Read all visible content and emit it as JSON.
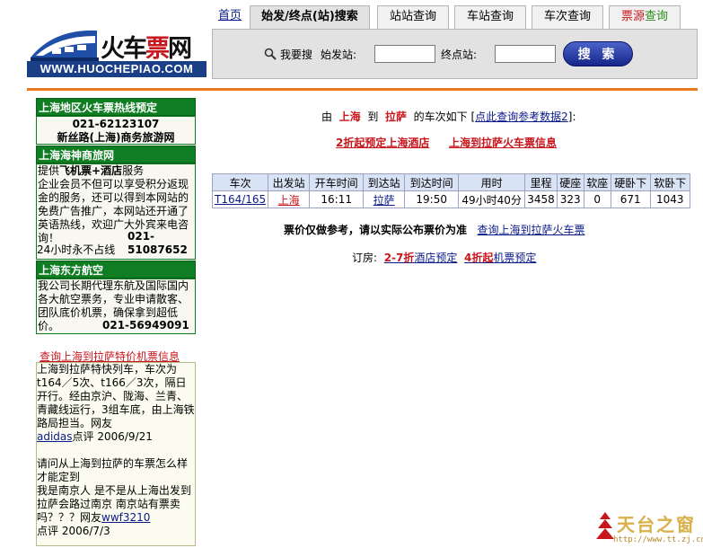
{
  "logo": {
    "cn_prefix": "火车",
    "cn_red": "票",
    "cn_suffix": "网",
    "en": "WWW.HUOCHEPIAO.COM"
  },
  "tabs": [
    {
      "label": "首页"
    },
    {
      "label": "始发/终点(站)搜索"
    },
    {
      "label": "站站查询"
    },
    {
      "label": "车站查询"
    },
    {
      "label": "车次查询"
    },
    {
      "label_a": "票源",
      "label_b": "查询"
    }
  ],
  "search": {
    "prompt": "我要搜",
    "from_label": "始发站:",
    "from_value": "",
    "to_label": "终点站:",
    "to_value": "",
    "button": "搜 索"
  },
  "sidebar": {
    "hotline": {
      "title": "上海地区火车票热线预定",
      "phone": "021-62123107",
      "company": "新丝路(上海)商务旅游网"
    },
    "shenshang": {
      "title": "上海海神商旅网",
      "text_a": "提供",
      "text_b": "飞机票+酒店",
      "text_c": "服务",
      "text_d": "企业会员不但可以享受积分返现金的服务，还可以得到本网站的免费广告推广，本网站还开通了英语热线，欢迎广大外宾来电咨询！",
      "phone": "021-51087652",
      "hours": "24小时永不占线"
    },
    "eastern": {
      "title": "上海东方航空",
      "text": "我公司长期代理东航及国际国内各大航空票务，专业申请散客、团队底价机票，确保拿到超低价。",
      "phone": "021-56949091"
    },
    "flight_link": "查询上海到拉萨特价机票信息",
    "comments": {
      "c1_text": "上海到拉萨特快列车，车次为t164／5次、t166／3次，隔日开行。经由京沪、陇海、兰青、青藏线运行，3组车底，由上海铁路局担当。网友",
      "c1_user": "adidas",
      "c1_meta": "点评 2006/9/21",
      "c2_text": "请问从上海到拉萨的车票怎么样才能定到\n我是南京人 是不是从上海出发到拉萨会路过南京 南京站有票卖吗？？？网友",
      "c2_user": "wwf3210",
      "c2_meta": "点评 2006/7/3"
    }
  },
  "main": {
    "intro_a": "由",
    "from": "上海",
    "intro_b": "到",
    "to": "拉萨",
    "intro_c": "的车次如下",
    "ref_open": "[",
    "ref_link": "点此查询参考数据2",
    "ref_close": "]:",
    "promo_hotel": "2折起预定上海酒店",
    "promo_ticket": "上海到拉萨火车票信息",
    "table": {
      "headers": [
        "车次",
        "出发站",
        "开车时间",
        "到达站",
        "到达时间",
        "用时",
        "里程",
        "硬座",
        "软座",
        "硬卧下",
        "软卧下"
      ],
      "rows": [
        [
          "T164/165",
          "上海",
          "16:11",
          "拉萨",
          "19:50",
          "49小时40分",
          "3458",
          "323",
          "0",
          "671",
          "1043"
        ]
      ]
    },
    "note_bold": "票价仅做参考，请以实际公布票价为准",
    "note_link": "查询上海到拉萨火车票",
    "booking_label": "订房:",
    "booking_hotel_red": "2-7折",
    "booking_hotel": "酒店预定",
    "booking_air_red": "4折起",
    "booking_air": "机票预定"
  },
  "watermark": {
    "text": "天台之窗",
    "url": "http://www.tt.zj.cn"
  }
}
